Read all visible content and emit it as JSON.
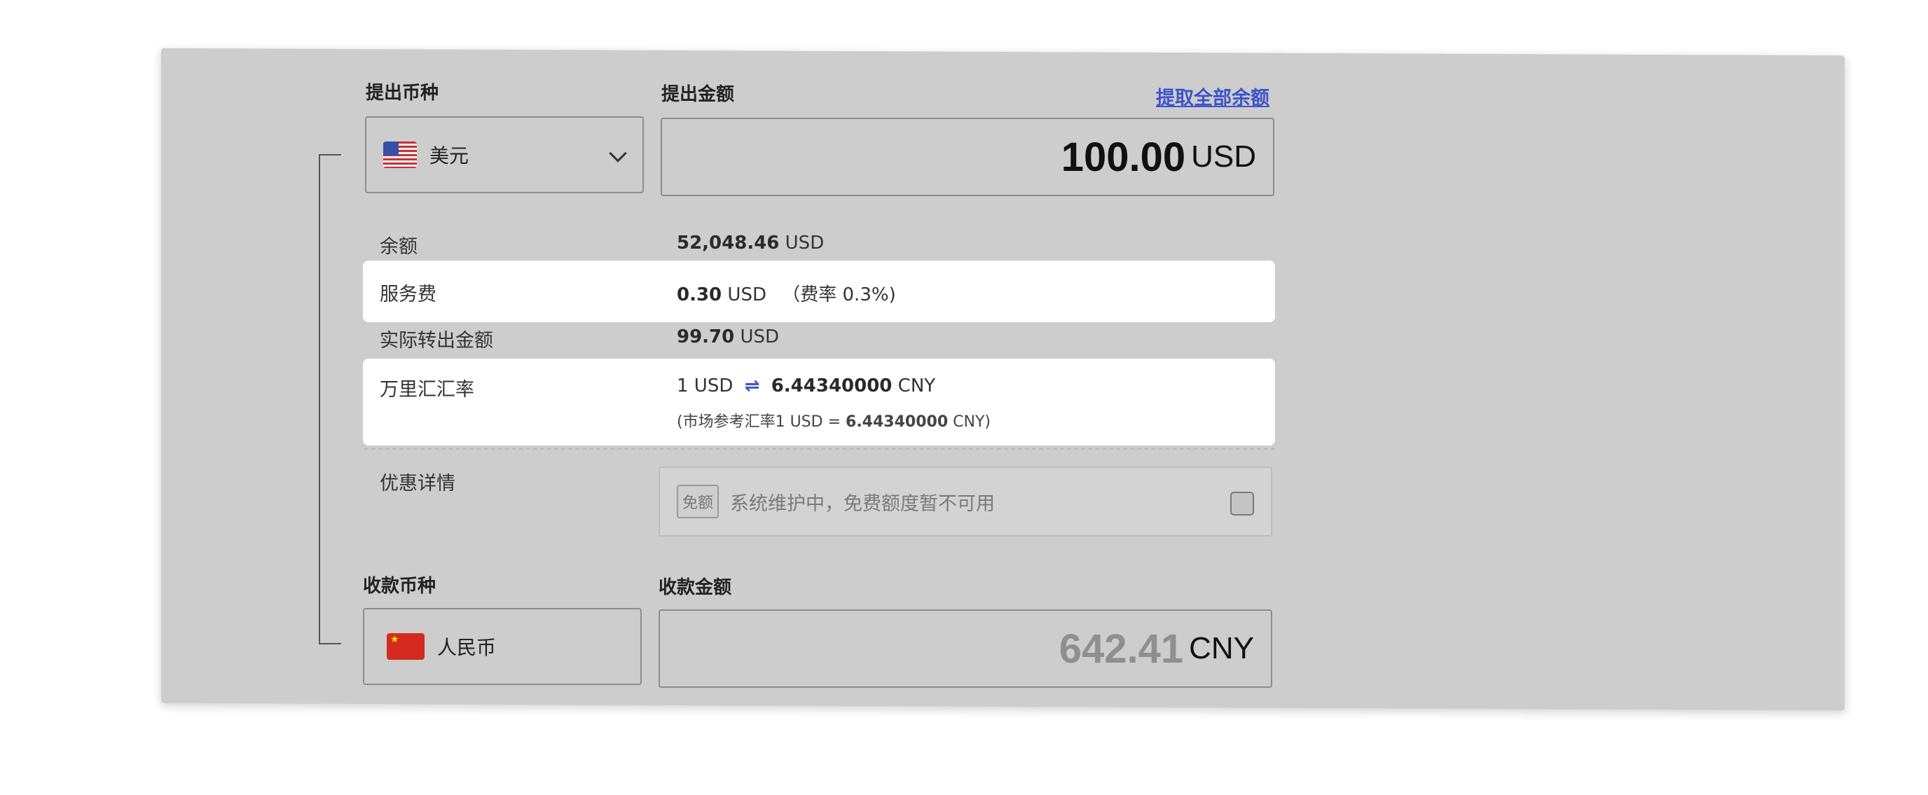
{
  "send": {
    "currency_label": "提出币种",
    "amount_label": "提出金额",
    "withdraw_all_link": "提取全部余额",
    "currency_value": "美元",
    "amount_value": "100.00",
    "amount_currency": "USD"
  },
  "details": {
    "balance": {
      "label": "余额",
      "amount": "52,048.46",
      "currency": "USD"
    },
    "service_fee": {
      "label": "服务费",
      "amount": "0.30",
      "currency": "USD",
      "rate_note": "（费率 0.3%)"
    },
    "actual_out": {
      "label": "实际转出金额",
      "amount": "99.70",
      "currency": "USD"
    },
    "rate": {
      "label": "万里汇汇率",
      "from": "1 USD",
      "swap_symbol": "⇌",
      "to_amount": "6.44340000",
      "to_currency": "CNY",
      "market_prefix": "(市场参考汇率1 USD = ",
      "market_amount": "6.44340000",
      "market_suffix": " CNY)"
    },
    "promo": {
      "label": "优惠详情",
      "tag": "免额",
      "text": "系统维护中，免费额度暂不可用"
    }
  },
  "receive": {
    "currency_label": "收款币种",
    "amount_label": "收款金额",
    "currency_value": "人民币",
    "amount_value": "642.41",
    "amount_currency": "CNY"
  },
  "colors": {
    "panel_bg": "#cdcdcd",
    "link": "#3d54c9",
    "band": "#ffffff"
  },
  "icons": {
    "send_flag": "us-flag-icon",
    "receive_flag": "cn-flag-icon",
    "dropdown": "chevron-down-icon",
    "swap": "swap-arrows-icon"
  }
}
